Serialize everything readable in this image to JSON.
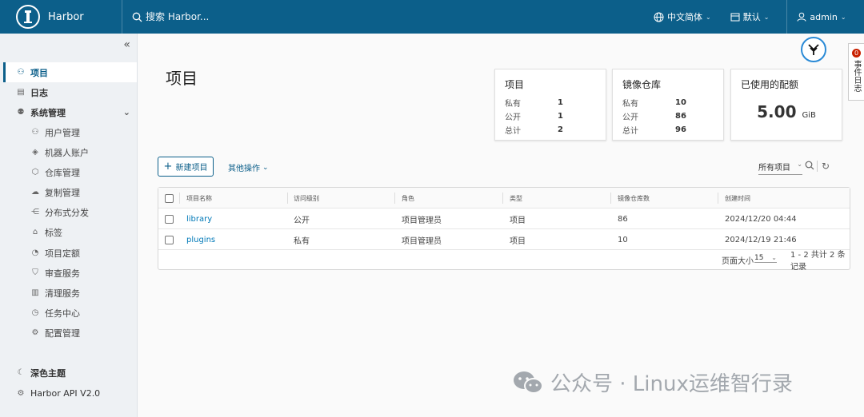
{
  "header": {
    "brand": "Harbor",
    "search_placeholder": "搜索 Harbor...",
    "language": "中文简体",
    "date_format": "默认",
    "user": "admin"
  },
  "sidebar": {
    "items": [
      {
        "label": "项目",
        "icon": "projects-icon"
      },
      {
        "label": "日志",
        "icon": "logs-icon"
      },
      {
        "label": "系统管理",
        "icon": "admin-icon"
      },
      {
        "label": "用户管理",
        "icon": "users-icon"
      },
      {
        "label": "机器人账户",
        "icon": "robot-icon"
      },
      {
        "label": "仓库管理",
        "icon": "registry-icon"
      },
      {
        "label": "复制管理",
        "icon": "replication-icon"
      },
      {
        "label": "分布式分发",
        "icon": "distribution-icon"
      },
      {
        "label": "标签",
        "icon": "tag-icon"
      },
      {
        "label": "项目定额",
        "icon": "quota-icon"
      },
      {
        "label": "审查服务",
        "icon": "shield-icon"
      },
      {
        "label": "清理服务",
        "icon": "trash-icon"
      },
      {
        "label": "任务中心",
        "icon": "clock-icon"
      },
      {
        "label": "配置管理",
        "icon": "gear-icon"
      }
    ],
    "theme_label": "深色主题",
    "api_label": "Harbor API V2.0"
  },
  "main": {
    "title": "项目",
    "event_tab": "事件日志",
    "event_badge": "0",
    "cards": {
      "projects": {
        "title": "项目",
        "private_label": "私有",
        "private": "1",
        "public_label": "公开",
        "public": "1",
        "total_label": "总计",
        "total": "2"
      },
      "repos": {
        "title": "镜像仓库",
        "private_label": "私有",
        "private": "10",
        "public_label": "公开",
        "public": "86",
        "total_label": "总计",
        "total": "96"
      },
      "quota": {
        "title": "已使用的配额",
        "value": "5.00",
        "unit": "GiB"
      }
    },
    "new_project_label": "新建项目",
    "other_actions_label": "其他操作",
    "filter_label": "所有项目"
  },
  "table": {
    "columns": [
      "项目名称",
      "访问级别",
      "角色",
      "类型",
      "镜像仓库数",
      "创建时间"
    ],
    "rows": [
      {
        "name": "library",
        "access": "公开",
        "role": "项目管理员",
        "type": "项目",
        "repos": "86",
        "created": "2024/12/20 04:44"
      },
      {
        "name": "plugins",
        "access": "私有",
        "role": "项目管理员",
        "type": "项目",
        "repos": "10",
        "created": "2024/12/19 21:46"
      }
    ],
    "page_size_label": "页面大小",
    "page_size": "15",
    "summary": "1 - 2 共计 2 条记录"
  },
  "watermark": "公众号 · Linux运维智行录"
}
